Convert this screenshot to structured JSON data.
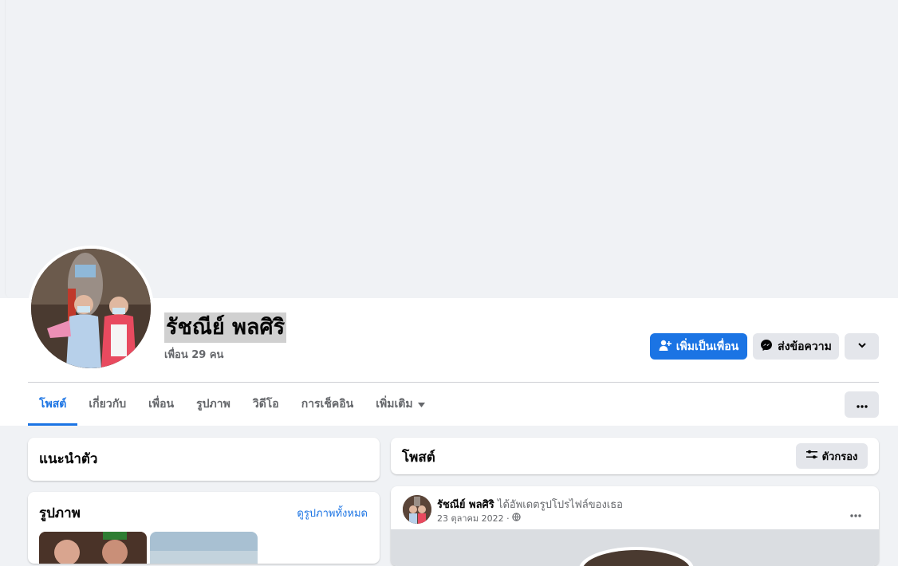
{
  "profile": {
    "name": "รัชณีย์ พลศิริ",
    "friends": "เพื่อน 29 คน"
  },
  "actions": {
    "add_friend": "เพิ่มเป็นเพื่อน",
    "message": "ส่งข้อความ"
  },
  "tabs": [
    {
      "label": "โพสต์",
      "active": true
    },
    {
      "label": "เกี่ยวกับ"
    },
    {
      "label": "เพื่อน"
    },
    {
      "label": "รูปภาพ"
    },
    {
      "label": "วิดีโอ"
    },
    {
      "label": "การเช็คอิน"
    },
    {
      "label": "เพิ่มเติม"
    }
  ],
  "intro": {
    "title": "แนะนำตัว"
  },
  "photos": {
    "title": "รูปภาพ",
    "see_all": "ดูรูปภาพทั้งหมด"
  },
  "posts_header": {
    "title": "โพสต์",
    "filter": "ตัวกรอง"
  },
  "post": {
    "author": "รัชณีย์ พลศิริ",
    "action": "ได้อัพเดตรูปโปรไฟล์ของเธอ",
    "date": "23 ตุลาคม 2022 ·"
  },
  "colors": {
    "accent": "#1b74e4",
    "background": "#f0f2f5"
  }
}
